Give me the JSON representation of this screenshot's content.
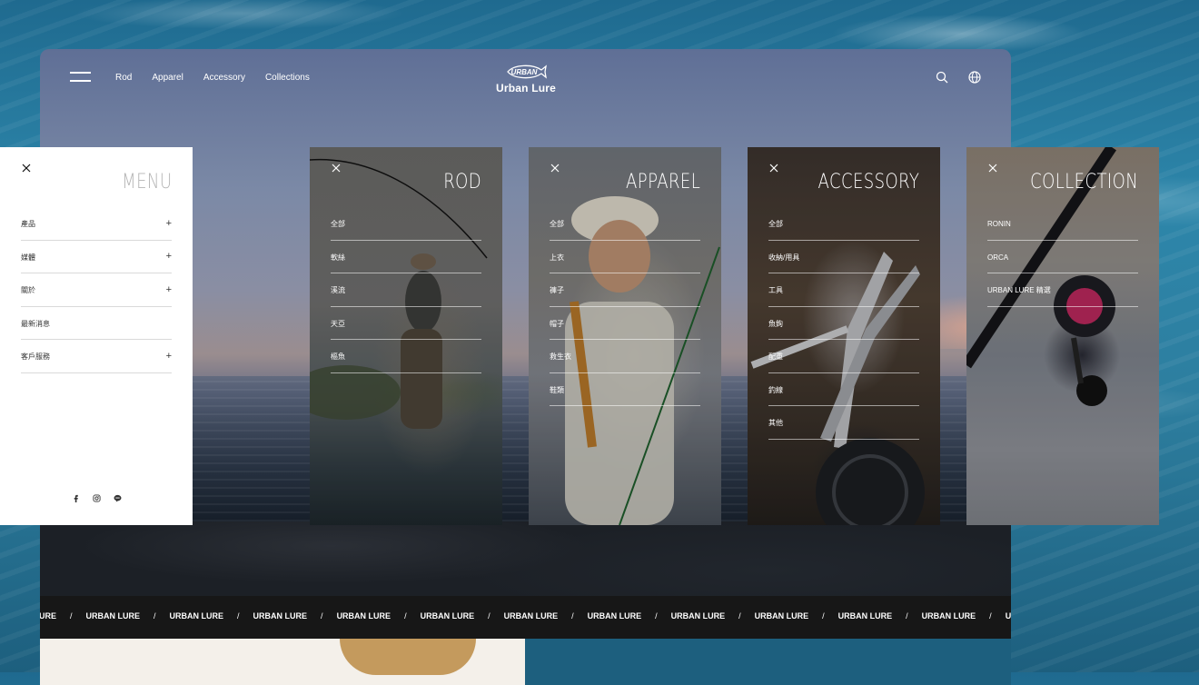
{
  "header": {
    "nav": [
      "Rod",
      "Apparel",
      "Accessory",
      "Collections"
    ],
    "logo_mark": "URBAN",
    "brand": "Urban Lure"
  },
  "panels": {
    "menu": {
      "title": "MENU",
      "items": [
        {
          "label": "產品",
          "expandable": true
        },
        {
          "label": "媒體",
          "expandable": true
        },
        {
          "label": "關於",
          "expandable": true
        },
        {
          "label": "最新消息",
          "expandable": false
        },
        {
          "label": "客戶服務",
          "expandable": true
        }
      ],
      "plus": "+",
      "social_icons": [
        "facebook-icon",
        "instagram-icon",
        "line-icon"
      ]
    },
    "rod": {
      "title": "ROD",
      "items": [
        "全部",
        "軟絲",
        "溪流",
        "天亞",
        "樞魚"
      ]
    },
    "apparel": {
      "title": "APPAREL",
      "items": [
        "全部",
        "上衣",
        "褲子",
        "帽子",
        "救生衣",
        "鞋類"
      ]
    },
    "accessory": {
      "title": "ACCESSORY",
      "items": [
        "全部",
        "收納/用具",
        "工具",
        "魚鉤",
        "配重",
        "釣線",
        "其他"
      ]
    },
    "collection": {
      "title": "COLLECTION",
      "items": [
        "RONIN",
        "ORCA",
        "URBAN LURE 精選"
      ]
    }
  },
  "marquee": {
    "text": "URBAN LURE",
    "separator": "/",
    "partial_start": "AN LURE",
    "partial_end": "U"
  },
  "colors": {
    "marquee_bg": "#171717",
    "menu_bg": "#ffffff",
    "menu_title": "#b4b4b4"
  }
}
